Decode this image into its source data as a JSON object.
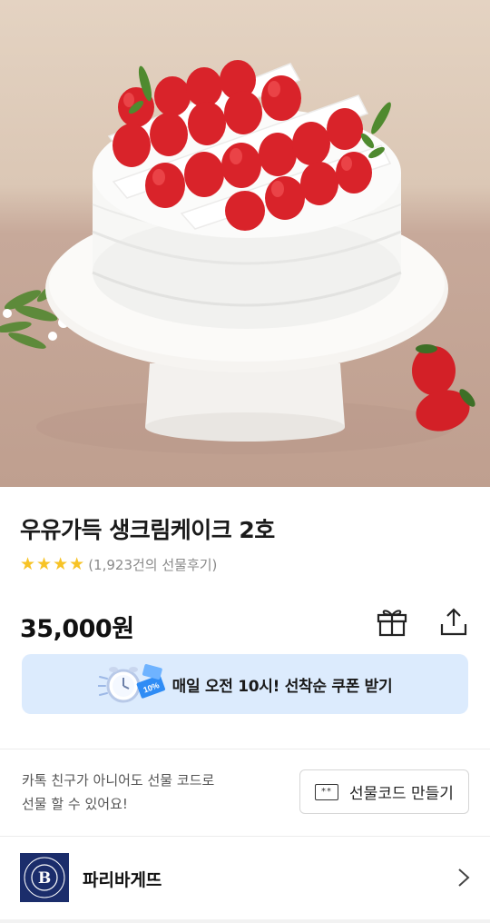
{
  "hero": {
    "image_alt": "strawberry fresh cream cake",
    "icon": "cake-photo"
  },
  "product": {
    "title": "우유가득 생크림케이크 2호",
    "rating_stars": 4,
    "review_count": "(1,923건의 선물후기)",
    "price": "35,000원"
  },
  "actions": {
    "gift_icon": "gift-icon",
    "share_icon": "share-icon"
  },
  "coupon": {
    "text": "매일 오전 10시! 선착순 쿠폰 받기",
    "badge": "10%"
  },
  "gift_code": {
    "note_line1": "카톡 친구가 아니어도 선물 코드로",
    "note_line2": "선물 할 수 있어요!",
    "button_label": "선물코드 만들기",
    "icon_text": "**"
  },
  "brand": {
    "name": "파리바게뜨",
    "logo_letter": "B",
    "logo_ring_text": "PARIS BAGUETTE · BOULANGERIE"
  },
  "colors": {
    "star": "#f7c326",
    "coupon_bg": "#dcebfd",
    "brand_logo_bg": "#1b2d6b"
  }
}
